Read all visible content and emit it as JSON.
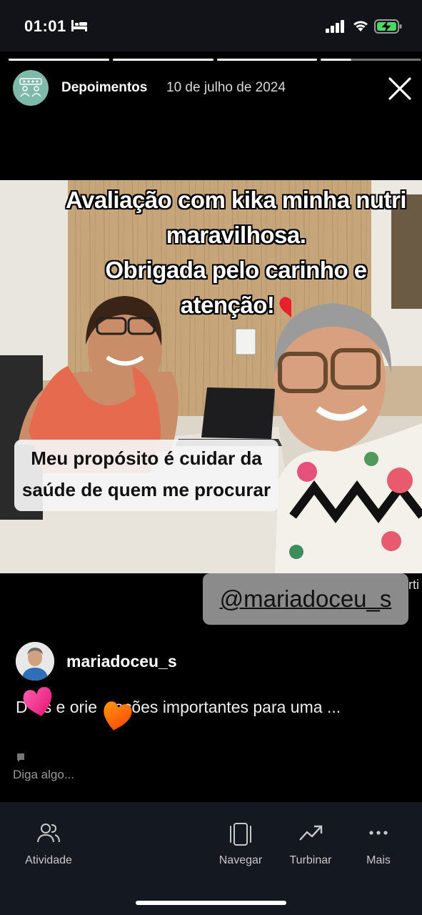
{
  "status_bar": {
    "time": "01:01"
  },
  "story": {
    "account_name": "Depoimentos",
    "date": "10 de julho de 2024",
    "caption_top": [
      "Avaliação com kika minha nutri",
      "maravilhosa.",
      "Obrigada pelo carinho e atenção!"
    ],
    "caption_box": [
      "Meu propósito é cuidar da",
      "saúde de quem me procurar"
    ],
    "mention": "@mariadoceu_s",
    "edge_text": "rti",
    "username": "mariadoceu_s",
    "description": "Dicas e orientações importantes para uma ...",
    "description_visible": [
      "D",
      "s e orie",
      "ações importantes para uma ..."
    ],
    "reply_placeholder": "Diga algo..."
  },
  "tabbar": {
    "items": [
      {
        "label": "Atividade",
        "icon": "people-icon"
      },
      {
        "label": "Navegar",
        "icon": "navigate-icon"
      },
      {
        "label": "Turbinar",
        "icon": "trend-up-icon"
      },
      {
        "label": "Mais",
        "icon": "more-dots-icon"
      }
    ]
  },
  "colors": {
    "avatar_bg": "#7fb9a9",
    "heart_pink": "#ff2d8a",
    "heart_orange": "#ff6a00",
    "tabbar_bg": "#141820"
  }
}
